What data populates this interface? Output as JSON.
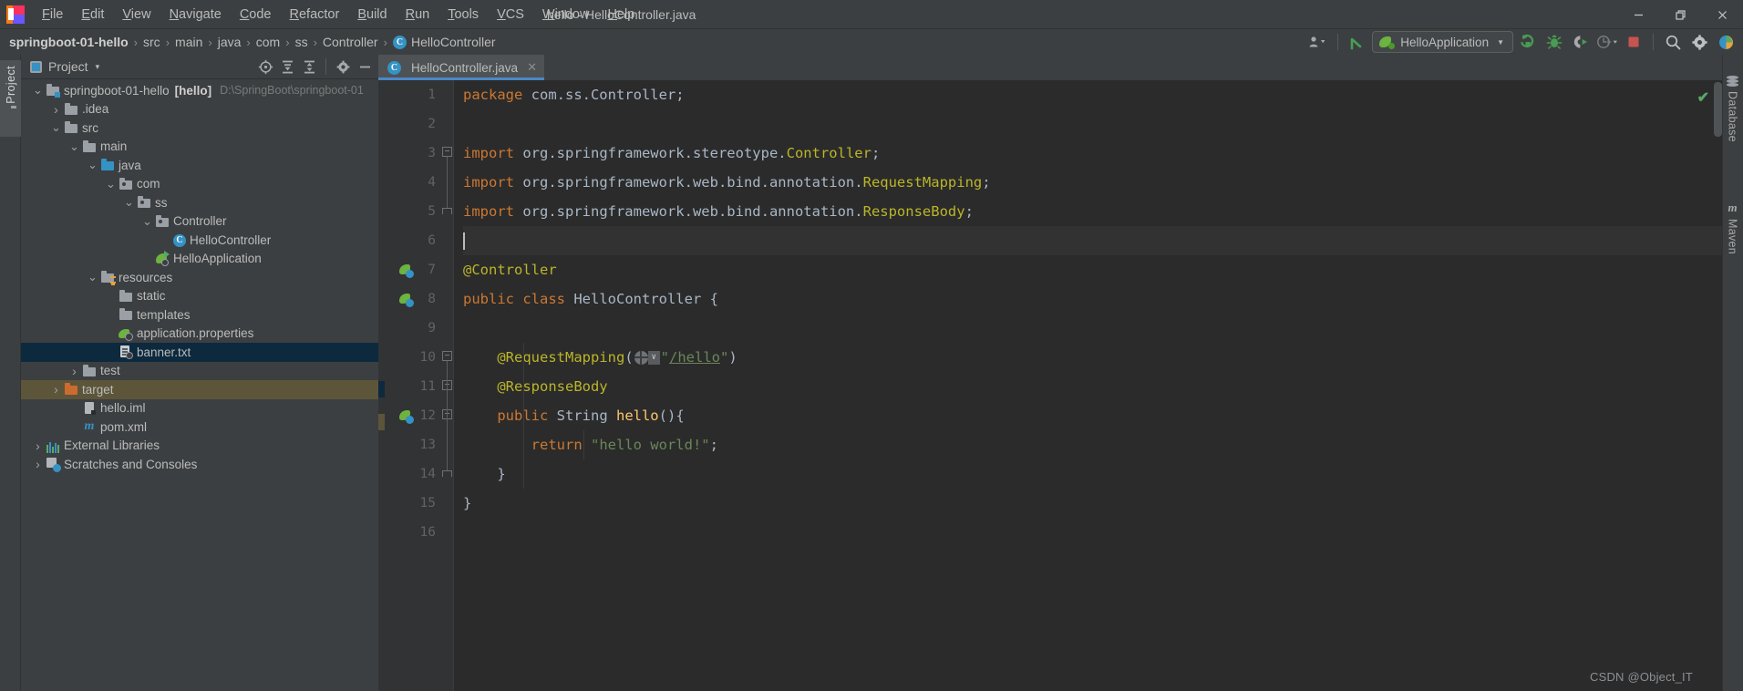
{
  "window": {
    "title": "hello - HelloController.java",
    "minimize": "—",
    "maximize": "❐",
    "close": "✕"
  },
  "menubar": [
    {
      "label": "File"
    },
    {
      "label": "Edit"
    },
    {
      "label": "View"
    },
    {
      "label": "Navigate"
    },
    {
      "label": "Code"
    },
    {
      "label": "Refactor"
    },
    {
      "label": "Build"
    },
    {
      "label": "Run"
    },
    {
      "label": "Tools"
    },
    {
      "label": "VCS"
    },
    {
      "label": "Window"
    },
    {
      "label": "Help"
    }
  ],
  "breadcrumb": {
    "separator": "›",
    "items": [
      {
        "label": "springboot-01-hello",
        "bold": true
      },
      {
        "label": "src"
      },
      {
        "label": "main"
      },
      {
        "label": "java"
      },
      {
        "label": "com"
      },
      {
        "label": "ss"
      },
      {
        "label": "Controller"
      },
      {
        "label": "HelloController",
        "icon": "class-icon",
        "icon_letter": "C"
      }
    ]
  },
  "toolbar": {
    "run_configuration": "HelloApplication",
    "run_config_icon": "spring-boot-icon",
    "dropdown_caret": "▼",
    "buttons": [
      {
        "name": "user-account-icon",
        "label": ""
      },
      {
        "name": "update-project-icon",
        "label": ""
      },
      {
        "name": "run-button",
        "label": ""
      },
      {
        "name": "debug-button",
        "label": ""
      },
      {
        "name": "run-with-coverage-button",
        "label": ""
      },
      {
        "name": "profiler-button",
        "label": ""
      },
      {
        "name": "stop-button",
        "label": ""
      },
      {
        "name": "search-everywhere-icon",
        "label": ""
      },
      {
        "name": "settings-gear-icon",
        "label": ""
      },
      {
        "name": "ide-help-icon",
        "label": ""
      }
    ]
  },
  "left_strip": {
    "tabs": [
      {
        "label": "Project",
        "icon": "folder-icon"
      }
    ]
  },
  "right_strip": {
    "tabs": [
      {
        "label": "Database",
        "icon": "database-icon"
      },
      {
        "label": "Maven",
        "icon": "maven-icon"
      }
    ]
  },
  "project_panel": {
    "title": "Project",
    "caret": "▾",
    "actions": [
      {
        "name": "select-opened-file-icon"
      },
      {
        "name": "expand-all-icon"
      },
      {
        "name": "collapse-all-icon"
      },
      {
        "name": "panel-settings-icon"
      },
      {
        "name": "hide-panel-icon"
      }
    ],
    "tree": [
      {
        "label": "springboot-01-hello",
        "suffix": "[hello]",
        "path": "D:\\SpringBoot\\springboot-01",
        "indent": 0,
        "arrow": "⌄",
        "icon": "module-folder-icon",
        "state": "normal"
      },
      {
        "label": ".idea",
        "indent": 1,
        "arrow": "›",
        "icon": "folder-icon",
        "state": "normal"
      },
      {
        "label": "src",
        "indent": 1,
        "arrow": "⌄",
        "icon": "folder-icon",
        "state": "normal"
      },
      {
        "label": "main",
        "indent": 2,
        "arrow": "⌄",
        "icon": "folder-icon",
        "state": "normal"
      },
      {
        "label": "java",
        "indent": 3,
        "arrow": "⌄",
        "icon": "source-folder-icon",
        "state": "normal"
      },
      {
        "label": "com",
        "indent": 4,
        "arrow": "⌄",
        "icon": "package-icon",
        "state": "normal"
      },
      {
        "label": "ss",
        "indent": 5,
        "arrow": "⌄",
        "icon": "package-icon",
        "state": "normal"
      },
      {
        "label": "Controller",
        "indent": 6,
        "arrow": "⌄",
        "icon": "package-icon",
        "state": "normal"
      },
      {
        "label": "HelloController",
        "indent": 7,
        "arrow": "",
        "icon": "java-class-icon",
        "state": "normal"
      },
      {
        "label": "HelloApplication",
        "indent": 6,
        "arrow": "",
        "icon": "spring-boot-app-icon",
        "state": "normal"
      },
      {
        "label": "resources",
        "indent": 3,
        "arrow": "⌄",
        "icon": "resources-folder-icon",
        "state": "normal"
      },
      {
        "label": "static",
        "indent": 4,
        "arrow": "",
        "icon": "folder-icon",
        "state": "normal"
      },
      {
        "label": "templates",
        "indent": 4,
        "arrow": "",
        "icon": "folder-icon",
        "state": "normal"
      },
      {
        "label": "application.properties",
        "indent": 4,
        "arrow": "",
        "icon": "spring-properties-icon",
        "state": "normal"
      },
      {
        "label": "banner.txt",
        "indent": 4,
        "arrow": "",
        "icon": "text-file-icon",
        "state": "selected"
      },
      {
        "label": "test",
        "indent": 2,
        "arrow": "›",
        "icon": "folder-icon",
        "state": "normal"
      },
      {
        "label": "target",
        "indent": 1,
        "arrow": "›",
        "icon": "excluded-folder-icon",
        "state": "excluded"
      },
      {
        "label": "hello.iml",
        "indent": 2,
        "arrow": "",
        "icon": "iml-file-icon",
        "state": "normal"
      },
      {
        "label": "pom.xml",
        "indent": 2,
        "arrow": "",
        "icon": "maven-pom-icon",
        "state": "normal"
      },
      {
        "label": "External Libraries",
        "indent": 0,
        "arrow": "›",
        "icon": "external-libraries-icon",
        "state": "normal"
      },
      {
        "label": "Scratches and Consoles",
        "indent": 0,
        "arrow": "›",
        "icon": "scratches-icon",
        "state": "normal"
      }
    ]
  },
  "editor": {
    "tab": {
      "label": "HelloController.java",
      "icon": "java-class-icon",
      "icon_letter": "C",
      "close": "✕"
    },
    "inspection_status": "✔",
    "line_numbers": [
      1,
      2,
      3,
      4,
      5,
      6,
      7,
      8,
      9,
      10,
      11,
      12,
      13,
      14,
      15,
      16
    ],
    "gutter_markers": [
      {
        "line": 7,
        "icon": "spring-bean-icon"
      },
      {
        "line": 8,
        "icon": "spring-bean-gutter-icon"
      },
      {
        "line": 12,
        "icon": "spring-mapping-icon"
      }
    ],
    "fold_markers": [
      {
        "line": 3,
        "type": "collapse-region"
      },
      {
        "line": 5,
        "type": "region-end"
      },
      {
        "line": 10,
        "type": "collapse-method"
      },
      {
        "line": 11,
        "type": "collapse-method"
      },
      {
        "line": 12,
        "type": "collapse-method"
      },
      {
        "line": 14,
        "type": "region-end"
      }
    ],
    "code_lines": [
      {
        "n": 1,
        "tokens": [
          {
            "t": "package ",
            "c": "kw"
          },
          {
            "t": "com.ss.Controller;",
            "c": "pln"
          }
        ]
      },
      {
        "n": 2,
        "tokens": []
      },
      {
        "n": 3,
        "tokens": [
          {
            "t": "import ",
            "c": "kw"
          },
          {
            "t": "org.springframework.stereotype.",
            "c": "pln"
          },
          {
            "t": "Controller",
            "c": "yel"
          },
          {
            "t": ";",
            "c": "pln"
          }
        ]
      },
      {
        "n": 4,
        "tokens": [
          {
            "t": "import ",
            "c": "kw"
          },
          {
            "t": "org.springframework.web.bind.annotation.",
            "c": "pln"
          },
          {
            "t": "RequestMapping",
            "c": "yel"
          },
          {
            "t": ";",
            "c": "pln"
          }
        ]
      },
      {
        "n": 5,
        "tokens": [
          {
            "t": "import ",
            "c": "kw"
          },
          {
            "t": "org.springframework.web.bind.annotation.",
            "c": "pln"
          },
          {
            "t": "ResponseBody",
            "c": "yel"
          },
          {
            "t": ";",
            "c": "pln"
          }
        ]
      },
      {
        "n": 6,
        "tokens": [],
        "caret": true
      },
      {
        "n": 7,
        "tokens": [
          {
            "t": "@Controller",
            "c": "ann"
          }
        ]
      },
      {
        "n": 8,
        "tokens": [
          {
            "t": "public ",
            "c": "kw"
          },
          {
            "t": "class ",
            "c": "kw"
          },
          {
            "t": "HelloController",
            "c": "typ"
          },
          {
            "t": " {",
            "c": "pln"
          }
        ]
      },
      {
        "n": 9,
        "tokens": []
      },
      {
        "n": 10,
        "tokens": [
          {
            "t": "    @RequestMapping",
            "c": "ann"
          },
          {
            "t": "(",
            "c": "pln"
          },
          {
            "t": "GLOBE",
            "c": "icon"
          },
          {
            "t": "\"",
            "c": "str"
          },
          {
            "t": "/hello",
            "c": "lnk"
          },
          {
            "t": "\"",
            "c": "str"
          },
          {
            "t": ")",
            "c": "pln"
          }
        ]
      },
      {
        "n": 11,
        "tokens": [
          {
            "t": "    @ResponseBody",
            "c": "ann"
          }
        ]
      },
      {
        "n": 12,
        "tokens": [
          {
            "t": "    public ",
            "c": "kw"
          },
          {
            "t": "String ",
            "c": "typ"
          },
          {
            "t": "hello",
            "c": "cls-name"
          },
          {
            "t": "(){",
            "c": "pln"
          }
        ]
      },
      {
        "n": 13,
        "tokens": [
          {
            "t": "        ",
            "c": "pln"
          },
          {
            "t": "return ",
            "c": "kw"
          },
          {
            "t": "\"hello world!\"",
            "c": "str"
          },
          {
            "t": ";",
            "c": "pln"
          }
        ]
      },
      {
        "n": 14,
        "tokens": [
          {
            "t": "    }",
            "c": "pln"
          }
        ]
      },
      {
        "n": 15,
        "tokens": [
          {
            "t": "}",
            "c": "pln"
          }
        ]
      },
      {
        "n": 16,
        "tokens": []
      }
    ]
  },
  "watermark": "CSDN @Object_IT",
  "colors": {
    "accent": "#3592c4",
    "spring_green": "#6db33f",
    "keyword": "#cc7832",
    "annotation": "#bbb529",
    "string": "#6a8759",
    "type": "#a9b7c6",
    "method": "#ffc66d",
    "selection": "#0d293e",
    "excluded": "#5c553a",
    "editor_bg": "#2b2b2b",
    "panel_bg": "#3c3f41"
  }
}
